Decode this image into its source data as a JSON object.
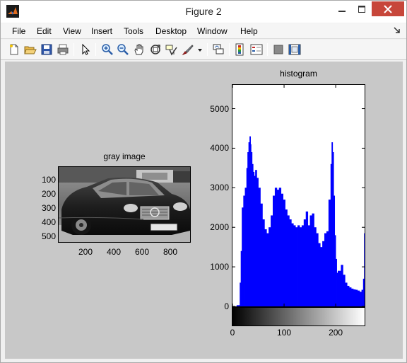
{
  "window": {
    "title": "Figure 2"
  },
  "menu": [
    "File",
    "Edit",
    "View",
    "Insert",
    "Tools",
    "Desktop",
    "Window",
    "Help"
  ],
  "toolbar": [
    {
      "name": "new-figure-icon"
    },
    {
      "name": "open-file-icon"
    },
    {
      "name": "save-icon"
    },
    {
      "name": "print-icon"
    },
    {
      "name": "edit-plot-arrow-icon"
    },
    {
      "name": "zoom-in-icon"
    },
    {
      "name": "zoom-out-icon"
    },
    {
      "name": "pan-hand-icon"
    },
    {
      "name": "rotate-3d-icon"
    },
    {
      "name": "data-cursor-icon"
    },
    {
      "name": "brush-icon"
    },
    {
      "name": "brush-dropdown-icon"
    },
    {
      "name": "link-plot-icon"
    },
    {
      "name": "colorbar-icon"
    },
    {
      "name": "legend-icon"
    },
    {
      "name": "hide-plot-tools-icon"
    },
    {
      "name": "show-plot-tools-icon"
    }
  ],
  "gray_image": {
    "title": "gray image",
    "x_ticks": [
      "200",
      "400",
      "600",
      "800"
    ],
    "y_ticks": [
      "100",
      "200",
      "300",
      "400",
      "500"
    ],
    "plate_text": "A 3·0104"
  },
  "chart_data": {
    "type": "bar",
    "title": "histogram",
    "xlabel": "",
    "ylabel": "",
    "xlim": [
      0,
      256
    ],
    "ylim": [
      0,
      5600
    ],
    "x_ticks": [
      0,
      100,
      200
    ],
    "y_ticks": [
      0,
      1000,
      2000,
      3000,
      4000,
      5000
    ],
    "bar_color": "#0000ff",
    "series": [
      {
        "x": [
          0,
          8,
          14,
          16,
          18,
          21,
          24,
          27,
          29,
          31,
          33,
          35,
          36,
          38,
          40,
          42,
          44,
          47,
          50,
          54,
          58,
          62,
          66,
          70,
          74,
          78,
          82,
          86,
          90,
          94,
          98,
          102,
          106,
          110,
          114,
          118,
          122,
          126,
          130,
          134,
          138,
          142,
          146,
          150,
          154,
          158,
          162,
          166,
          170,
          174,
          178,
          182,
          186,
          190,
          192,
          194,
          196,
          198,
          200,
          202,
          204,
          206,
          210,
          214,
          218,
          222,
          226,
          230,
          234,
          238,
          242,
          246,
          250,
          253,
          255
        ],
        "values": [
          0,
          30,
          600,
          1400,
          2500,
          2800,
          3000,
          3500,
          3900,
          4150,
          4300,
          4100,
          3900,
          3600,
          3400,
          3300,
          3450,
          3250,
          3000,
          2600,
          2200,
          1950,
          1850,
          2000,
          2300,
          2800,
          3000,
          2950,
          3000,
          2850,
          2700,
          2450,
          2300,
          2200,
          2100,
          2050,
          2000,
          2050,
          2000,
          2050,
          2200,
          2400,
          2050,
          2300,
          2350,
          2000,
          1850,
          1600,
          1500,
          1650,
          1850,
          1900,
          2700,
          3600,
          4150,
          3900,
          2800,
          1800,
          1200,
          850,
          900,
          900,
          1050,
          800,
          600,
          520,
          480,
          450,
          430,
          420,
          400,
          370,
          420,
          700,
          1850
        ]
      }
    ]
  }
}
